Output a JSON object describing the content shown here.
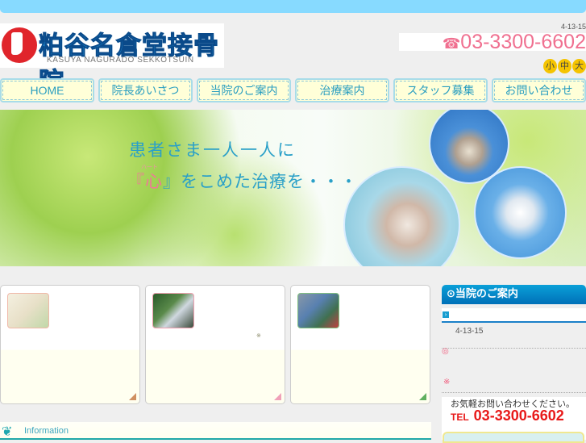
{
  "header": {
    "site_name": "粕谷名倉堂接骨院",
    "site_name_en": "KASUYA NAGURADO SEKKOTSUIN",
    "address": "4-13-15",
    "phone": "03-3300-6602",
    "phone_icon": "telephone-icon",
    "font_sizes": [
      "小",
      "中",
      "大"
    ]
  },
  "nav": [
    {
      "label": "HOME"
    },
    {
      "label": "院長あいさつ"
    },
    {
      "label": "当院のご案内"
    },
    {
      "label": "治療案内"
    },
    {
      "label": "スタッフ募集"
    },
    {
      "label": "お問い合わせ"
    }
  ],
  "banner": {
    "line1": "患者さま一人一人に",
    "line2_open": "『",
    "heart": "心",
    "ruby": "ハート",
    "line2_close": "』をこめた治療を・・・"
  },
  "cards": [
    {
      "accent": "#d09060"
    },
    {
      "accent": "#f0a0b8",
      "mark": "※"
    },
    {
      "accent": "#60b060"
    }
  ],
  "sidebar": {
    "title": "当院のご案内",
    "address": "4-13-15",
    "mark1": "◎",
    "mark2": "※",
    "contact_prompt": "お気軽お問い合わせください。",
    "tel_label": "TEL",
    "tel": "03-3300-6602"
  },
  "info": {
    "label": "Information"
  },
  "colors": {
    "top_bar": "#87daff",
    "nav_bg": "#ffffd8",
    "phone": "#f07090",
    "sidebar_header": "#0a88c8"
  }
}
